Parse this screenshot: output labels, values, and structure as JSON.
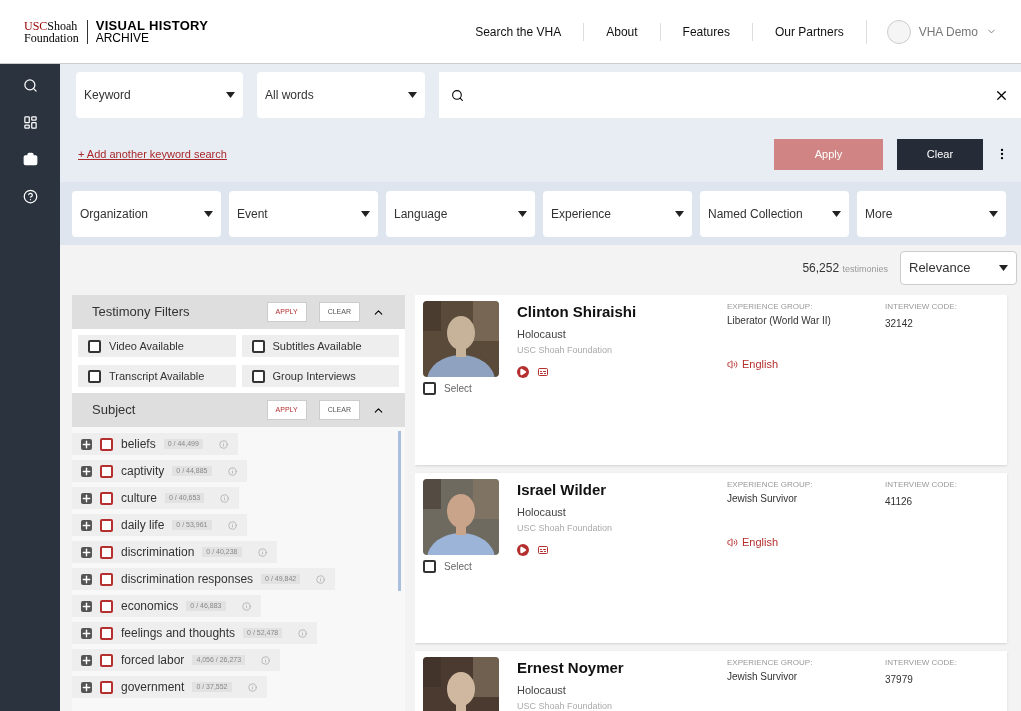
{
  "header": {
    "logo_top": "USCShoah",
    "logo_bottom": "Foundation",
    "title_top": "VISUAL HISTORY",
    "title_bottom": "ARCHIVE",
    "nav": [
      "Search the VHA",
      "About",
      "Features",
      "Our Partners"
    ],
    "user": "VHA Demo"
  },
  "search": {
    "scope": "Keyword",
    "match": "All words",
    "add_link": "+ Add another keyword search",
    "apply": "Apply",
    "clear": "Clear"
  },
  "filters": [
    "Organization",
    "Event",
    "Language",
    "Experience",
    "Named Collection",
    "More"
  ],
  "results_count": {
    "count": "56,252",
    "label": "testimonies"
  },
  "sort": "Relevance",
  "testimony_filters": {
    "title": "Testimony Filters",
    "apply": "APPLY",
    "clear": "CLEAR",
    "options": [
      {
        "label": "Video Available",
        "checked": false
      },
      {
        "label": "Subtitles Available",
        "checked": false
      },
      {
        "label": "Transcript Available",
        "checked": false
      },
      {
        "label": "Group Interviews",
        "checked": false
      }
    ]
  },
  "subject": {
    "title": "Subject",
    "apply": "APPLY",
    "clear": "CLEAR",
    "items": [
      {
        "label": "beliefs",
        "count": "0 / 44,499",
        "checked": false
      },
      {
        "label": "captivity",
        "count": "0 / 44,885",
        "checked": false
      },
      {
        "label": "culture",
        "count": "0 / 40,653",
        "checked": false
      },
      {
        "label": "daily life",
        "count": "0 / 53,961",
        "checked": false
      },
      {
        "label": "discrimination",
        "count": "0 / 40,238",
        "checked": false
      },
      {
        "label": "discrimination responses",
        "count": "0 / 49,842",
        "checked": false
      },
      {
        "label": "economics",
        "count": "0 / 46,883",
        "checked": false
      },
      {
        "label": "feelings and thoughts",
        "count": "0 / 52,478",
        "checked": false
      },
      {
        "label": "forced labor",
        "count": "4,056 / 26,273",
        "checked": false
      },
      {
        "label": "government",
        "count": "0 / 37,552",
        "checked": false
      }
    ]
  },
  "results": [
    {
      "name": "Clinton Shiraishi",
      "event": "Holocaust",
      "source": "USC Shoah Foundation",
      "group_label": "EXPERIENCE GROUP:",
      "group": "Liberator (World War II)",
      "code_label": "INTERVIEW CODE:",
      "code": "32142",
      "language": "English",
      "select": "Select",
      "selected": false
    },
    {
      "name": "Israel Wilder",
      "event": "Holocaust",
      "source": "USC Shoah Foundation",
      "group_label": "EXPERIENCE GROUP:",
      "group": "Jewish Survivor",
      "code_label": "INTERVIEW CODE:",
      "code": "41126",
      "language": "English",
      "select": "Select",
      "selected": false
    },
    {
      "name": "Ernest Noymer",
      "event": "Holocaust",
      "source": "USC Shoah Foundation",
      "group_label": "EXPERIENCE GROUP:",
      "group": "Jewish Survivor",
      "code_label": "INTERVIEW CODE:",
      "code": "37979"
    }
  ]
}
